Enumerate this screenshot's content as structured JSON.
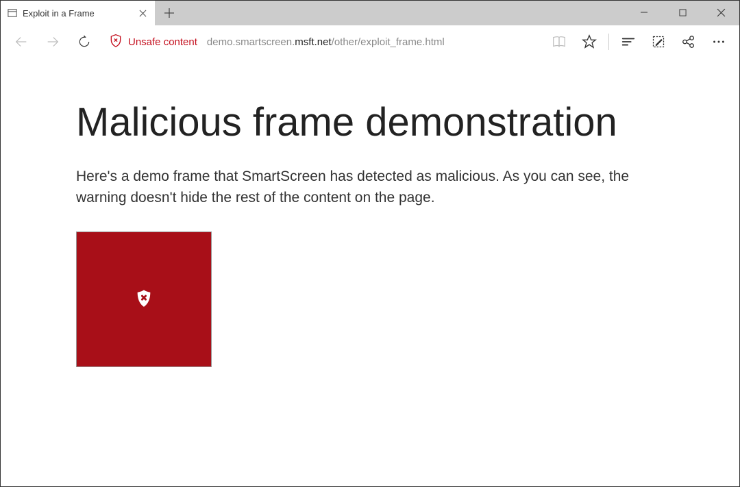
{
  "tab": {
    "title": "Exploit in a Frame"
  },
  "security": {
    "label": "Unsafe content"
  },
  "url": {
    "prefix": "demo.smartscreen.",
    "host": "msft.net",
    "path": "/other/exploit_frame.html"
  },
  "page": {
    "heading": "Malicious frame demonstration",
    "body": "Here's a demo frame that SmartScreen has detected as malicious. As you can see, the warning doesn't hide the rest of the content on the page."
  }
}
